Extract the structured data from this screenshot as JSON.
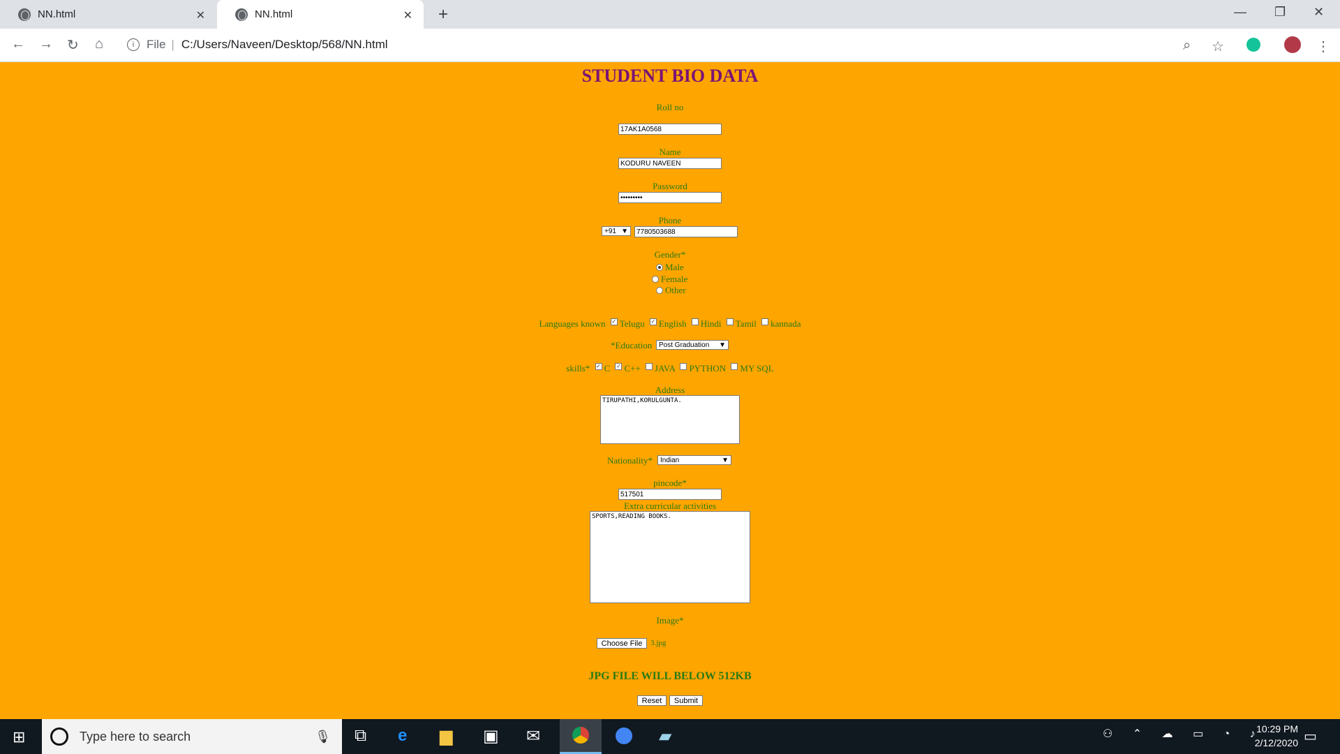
{
  "browser": {
    "tabs": [
      {
        "title": "NN.html",
        "active": false
      },
      {
        "title": "NN.html",
        "active": true
      }
    ],
    "address_prefix": "File",
    "address": "C:/Users/Naveen/Desktop/568/NN.html"
  },
  "form": {
    "title": "STUDENT BIO DATA",
    "rollno_label": "Roll no",
    "rollno_value": "17AK1A0568",
    "name_label": "Name",
    "name_value": "KODURU NAVEEN",
    "password_label": "Password",
    "password_value": "•••••••••",
    "phone_label": "Phone",
    "phone_code": "+91",
    "phone_value": "7780503688",
    "gender_label": "Gender*",
    "gender_options": [
      "Male",
      "Female",
      "Other"
    ],
    "gender_selected": "Male",
    "languages_label": "Languages known",
    "languages": [
      {
        "label": "Telugu",
        "checked": true
      },
      {
        "label": "English",
        "checked": true
      },
      {
        "label": "Hindi",
        "checked": false
      },
      {
        "label": "Tamil",
        "checked": false
      },
      {
        "label": "kannada",
        "checked": false
      }
    ],
    "education_label": "*Education",
    "education_value": "Post Graduation",
    "skills_label": "skills*",
    "skills": [
      {
        "label": "C",
        "checked": true
      },
      {
        "label": "C++",
        "checked": true
      },
      {
        "label": "JAVA",
        "checked": false
      },
      {
        "label": "PYTHON",
        "checked": false
      },
      {
        "label": "MY SQL",
        "checked": false
      }
    ],
    "address_label": "Address",
    "address_value": "TIRUPATHI,KORULGUNTA.",
    "nationality_label": "Nationality*",
    "nationality_value": "Indian",
    "pincode_label": "pincode*",
    "pincode_value": "517501",
    "extra_label": "Extra curricular activities",
    "extra_value": "SPORTS,READING BOOKS.",
    "image_label": "Image*",
    "choose_file": "Choose File",
    "file_name": "3.jpg",
    "note": "JPG FILE WILL BELOW 512KB",
    "reset": "Reset",
    "submit": "Submit"
  },
  "taskbar": {
    "search_placeholder": "Type here to search",
    "time": "10:29 PM",
    "date": "2/12/2020"
  },
  "colors": {
    "page_bg": "#fea500",
    "label": "#2b7a13",
    "title": "#7b1474"
  }
}
